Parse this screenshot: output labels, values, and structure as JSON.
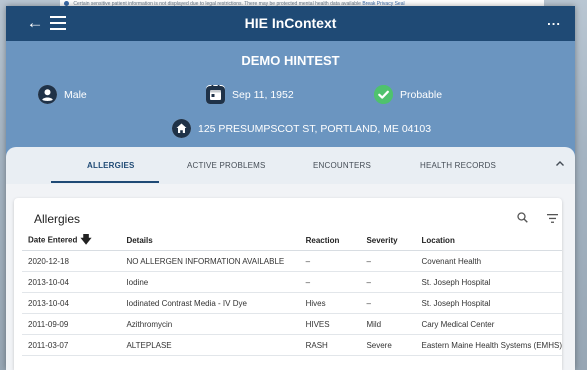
{
  "notice": {
    "text": "Certain sensitive patient information is not displayed due to legal restrictions. There may be protected mental health data available",
    "link": "Break Privacy Seal"
  },
  "app": {
    "title": "HIE InContext",
    "more": "..."
  },
  "patient": {
    "name": "DEMO HINTEST",
    "gender": "Male",
    "dob": "Sep 11, 1952",
    "status": "Probable",
    "address": "125 PRESUMPSCOT ST, PORTLAND, ME 04103"
  },
  "tabs": [
    {
      "label": "ALLERGIES",
      "active": true
    },
    {
      "label": "ACTIVE PROBLEMS",
      "active": false
    },
    {
      "label": "ENCOUNTERS",
      "active": false
    },
    {
      "label": "HEALTH RECORDS",
      "active": false
    }
  ],
  "allergies": {
    "title": "Allergies",
    "columns": [
      "Date Entered",
      "Details",
      "Reaction",
      "Severity",
      "Location"
    ],
    "rows": [
      [
        "2020-12-18",
        "NO ALLERGEN INFORMATION AVAILABLE",
        "–",
        "–",
        "Covenant Health"
      ],
      [
        "2013-10-04",
        "Iodine",
        "–",
        "–",
        "St. Joseph Hospital"
      ],
      [
        "2013-10-04",
        "Iodinated Contrast Media - IV Dye",
        "Hives",
        "–",
        "St. Joseph Hospital"
      ],
      [
        "2011-09-09",
        "Azithromycin",
        "HIVES",
        "Mild",
        "Cary Medical Center"
      ],
      [
        "2011-03-07",
        "ALTEPLASE",
        "RASH",
        "Severe",
        "Eastern Maine Health Systems (EMHS)"
      ]
    ]
  },
  "icons": {
    "back": "back-arrow-icon",
    "menu": "hamburger-menu-icon",
    "gender": "person-circle-icon",
    "dob": "calendar-icon",
    "status": "check-circle-icon",
    "address": "home-icon",
    "collapse": "chevron-up-icon",
    "search": "search-icon",
    "filter": "filter-icon",
    "sort": "sort-down-icon"
  },
  "colors": {
    "topbar": "#1f4a75",
    "banner": "#6b95c0",
    "status_ok": "#4fc26d"
  }
}
